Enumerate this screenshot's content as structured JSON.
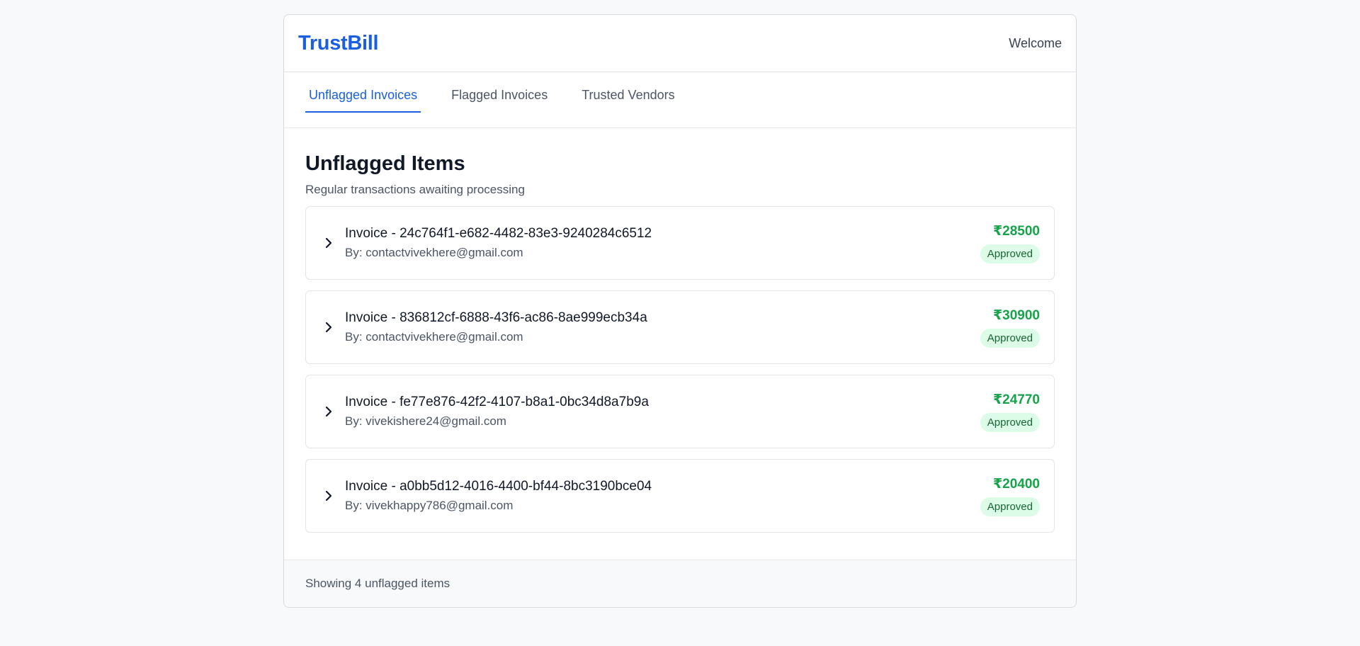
{
  "header": {
    "brand": "TrustBill",
    "welcome": "Welcome"
  },
  "tabs": [
    {
      "label": "Unflagged Invoices",
      "active": true
    },
    {
      "label": "Flagged Invoices",
      "active": false
    },
    {
      "label": "Trusted Vendors",
      "active": false
    }
  ],
  "main": {
    "title": "Unflagged Items",
    "subtitle": "Regular transactions awaiting processing"
  },
  "invoices": [
    {
      "title": "Invoice - 24c764f1-e682-4482-83e3-9240284c6512",
      "by": "By: contactvivekhere@gmail.com",
      "amount": "₹28500",
      "status": "Approved"
    },
    {
      "title": "Invoice - 836812cf-6888-43f6-ac86-8ae999ecb34a",
      "by": "By: contactvivekhere@gmail.com",
      "amount": "₹30900",
      "status": "Approved"
    },
    {
      "title": "Invoice - fe77e876-42f2-4107-b8a1-0bc34d8a7b9a",
      "by": "By: vivekishere24@gmail.com",
      "amount": "₹24770",
      "status": "Approved"
    },
    {
      "title": "Invoice - a0bb5d12-4016-4400-bf44-8bc3190bce04",
      "by": "By: vivekhappy786@gmail.com",
      "amount": "₹20400",
      "status": "Approved"
    }
  ],
  "footer": {
    "text": "Showing 4 unflagged items"
  },
  "icons": {
    "expand": "chevron-right-icon"
  },
  "colors": {
    "brand": "#1a5fe0",
    "amount": "#16a34a",
    "badge_bg": "#dcfce7",
    "badge_text": "#166534"
  }
}
